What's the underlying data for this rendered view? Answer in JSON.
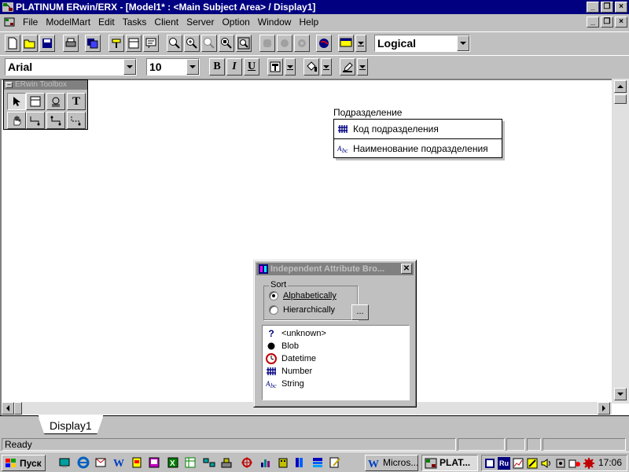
{
  "window": {
    "title": "PLATINUM ERwin/ERX - [Model1* : <Main Subject Area> / Display1]",
    "controls": [
      "minimize",
      "restore",
      "close"
    ]
  },
  "menubar": {
    "items": [
      {
        "label": "File"
      },
      {
        "label": "ModelMart"
      },
      {
        "label": "Edit"
      },
      {
        "label": "Tasks"
      },
      {
        "label": "Client"
      },
      {
        "label": "Server"
      },
      {
        "label": "Option"
      },
      {
        "label": "Window"
      },
      {
        "label": "Help"
      }
    ]
  },
  "toolbar1": {
    "icons": [
      "new-file-icon",
      "open-folder-icon",
      "save-icon",
      "print-icon",
      "copy-icon",
      "hammer-icon",
      "entity-icon",
      "comment-icon",
      "zoom-in-icon",
      "zoom-in-more-icon",
      "zoom-out-icon",
      "zoom-fit-icon",
      "zoom-window-icon",
      "disabled-icon-1",
      "disabled-icon-2",
      "disabled-icon-3",
      "globe-icon",
      "color-icon",
      "dropdown-arrow-icon"
    ],
    "view_mode": "Logical"
  },
  "toolbar2": {
    "font_name": "Arial",
    "font_size": "10",
    "bold": "B",
    "italic": "I",
    "underline": "U"
  },
  "toolbox": {
    "title": "ERwin Toolbox",
    "tools": [
      "pointer-icon",
      "entity-tool-icon",
      "subtype-icon",
      "text-tool-icon",
      "hand-icon",
      "identifying-relationship-icon",
      "many-to-many-relationship-icon",
      "non-identifying-relationship-icon"
    ]
  },
  "entity": {
    "name": "Подразделение",
    "key_attribute": "Код подразделения",
    "non_key_attribute": "Наименование подразделения"
  },
  "attribute_browser": {
    "title": "Independent Attribute Bro...",
    "sort_label": "Sort",
    "sort_options": [
      {
        "label": "Alphabetically",
        "checked": true
      },
      {
        "label": "Hierarchically",
        "checked": false
      }
    ],
    "ellipsis_label": "...",
    "items": [
      {
        "label": "<unknown>",
        "icon": "question-icon"
      },
      {
        "label": "Blob",
        "icon": "blob-icon"
      },
      {
        "label": "Datetime",
        "icon": "clock-icon"
      },
      {
        "label": "Number",
        "icon": "number-icon"
      },
      {
        "label": "String",
        "icon": "string-icon"
      }
    ]
  },
  "tabs": [
    {
      "label": "Display1"
    }
  ],
  "statusbar": {
    "status": "Ready"
  },
  "taskbar": {
    "start_label": "Пуск",
    "tasks": [
      {
        "label": "Micros..."
      },
      {
        "label": "PLAT..."
      }
    ],
    "clock": "17:06",
    "language": "Ru"
  },
  "colors": {
    "title_active": "#000080",
    "title_inactive": "#808080",
    "face": "#c0c0c0",
    "canvas": "#ffffff"
  }
}
